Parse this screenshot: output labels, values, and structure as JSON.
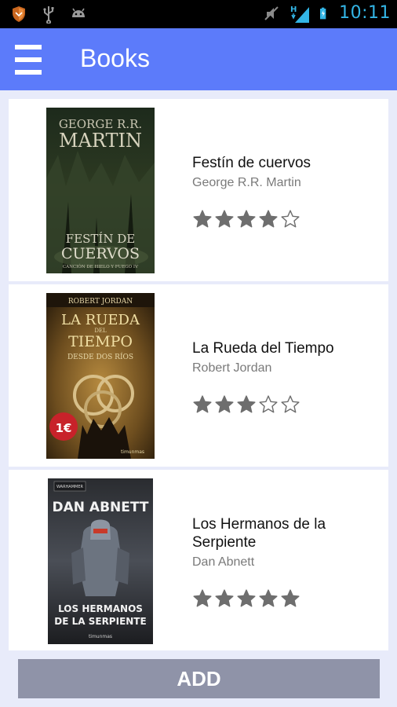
{
  "status_bar": {
    "time": "10:11",
    "network_label": "H",
    "icons": [
      "shield-icon",
      "usb-icon",
      "android-debug-icon",
      "mute-icon",
      "signal-icon",
      "battery-charging-icon"
    ]
  },
  "app_bar": {
    "title": "Books",
    "menu_icon": "hamburger-menu-icon"
  },
  "books": [
    {
      "title": "Festín de cuervos",
      "author": "George R.R. Martin",
      "rating": 4,
      "max_rating": 5,
      "cover": {
        "top_text": "GEORGE R.R.",
        "top_text2": "MARTIN",
        "main1": "FESTÍN DE",
        "main2": "CUERVOS",
        "sub": "CANCIÓN DE HIELO Y FUEGO IV"
      }
    },
    {
      "title": "La Rueda del Tiempo",
      "author": "Robert Jordan",
      "rating": 3,
      "max_rating": 5,
      "cover": {
        "top_text": "ROBERT JORDAN",
        "main1": "LA RUEDA",
        "main_small": "DEL",
        "main2": "TIEMPO",
        "sub": "DESDE DOS RÍOS",
        "badge": "1€",
        "publisher": "timunmas"
      }
    },
    {
      "title": "Los Hermanos de la Serpiente",
      "author": "Dan Abnett",
      "rating": 5,
      "max_rating": 5,
      "cover": {
        "brand": "WARHAMMER",
        "top_text": "DAN ABNETT",
        "main1": "LOS HERMANOS",
        "main2": "DE LA SERPIENTE",
        "publisher": "timunmas"
      }
    }
  ],
  "add_button": {
    "label": "ADD"
  },
  "colors": {
    "status_bar": "#000000",
    "status_accent": "#33b5e5",
    "app_bar": "#5c7bfa",
    "background": "#e8ebfa",
    "add_button": "#8f93a8",
    "star": "#6e6e6e"
  }
}
